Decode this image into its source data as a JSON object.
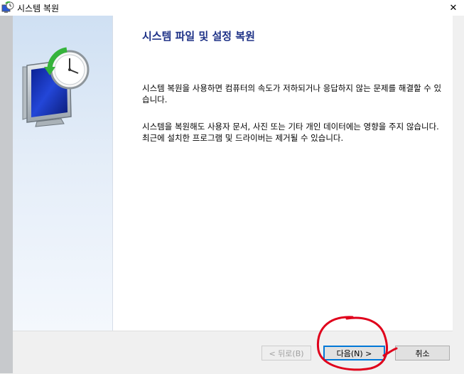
{
  "window": {
    "title": "시스템 복원",
    "close_symbol": "✕"
  },
  "content": {
    "heading": "시스템 파일 및 설정 복원",
    "paragraph1": "시스템 복원을 사용하면 컴퓨터의 속도가 저하되거나 응답하지 않는 문제를 해결할 수 있습니다.",
    "paragraph2": "시스템을 복원해도 사용자 문서, 사진 또는 기타 개인 데이터에는 영향을 주지 않습니다. 최근에 설치한 프로그램 및 드라이버는 제거될 수 있습니다."
  },
  "buttons": {
    "back_label": "< 뒤로(B)",
    "next_label": "다음(N) >",
    "cancel_label": "취소"
  },
  "icons": {
    "title": "system-restore-icon",
    "hero": "system-restore-clock-monitor-icon",
    "close": "close-icon"
  },
  "colors": {
    "heading": "#1e3287",
    "focus_border": "#0078d7",
    "annotation": "#e0001b"
  }
}
